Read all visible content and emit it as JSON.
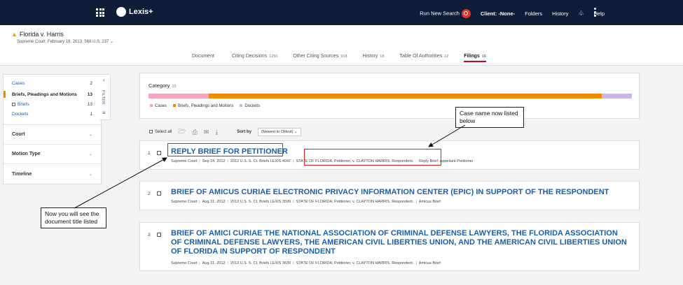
{
  "topbar": {
    "logo": "Lexis+",
    "run_new_search": "Run New Search",
    "client": "Client: -None-",
    "folders": "Folders",
    "history": "History",
    "help": "Help"
  },
  "case": {
    "title": "Florida v. Harris",
    "court": "Supreme Court",
    "date": "February 19, 2013",
    "citation": "568 U.S. 237"
  },
  "tabs": [
    {
      "label": "Document",
      "count": ""
    },
    {
      "label": "Citing Decisions",
      "count": "1250"
    },
    {
      "label": "Other Citing Sources",
      "count": "918"
    },
    {
      "label": "History",
      "count": "18"
    },
    {
      "label": "Table Of Authorities",
      "count": "12"
    },
    {
      "label": "Filings",
      "count": "16"
    }
  ],
  "sidebar": {
    "cases": {
      "label": "Cases",
      "count": "2"
    },
    "briefs_pleadings": {
      "label": "Briefs, Pleadings and Motions",
      "count": "13"
    },
    "briefs": {
      "label": "Briefs",
      "count": "13"
    },
    "dockets": {
      "label": "Dockets",
      "count": "1"
    },
    "sections": [
      "Court",
      "Motion Type",
      "Timeline"
    ],
    "filter_label": "FILTER"
  },
  "category": {
    "title": "Category",
    "count": "16",
    "legend": [
      {
        "label": "Cases",
        "color": "#f2a6c4"
      },
      {
        "label": "Briefs, Pleadings and Motions",
        "color": "#f08c00"
      },
      {
        "label": "Dockets",
        "color": "#c9b6e4"
      }
    ],
    "values": [
      2,
      13,
      1
    ]
  },
  "toolbar": {
    "select_all": "Select all",
    "sort_by": "Sort by",
    "sort_value": "(Newest to Oldest)"
  },
  "results": [
    {
      "num": "1",
      "title": "REPLY BRIEF FOR PETITIONER",
      "court": "Supreme Court",
      "date": "Sep 24, 2012",
      "cite": "2012 U.S. S. Ct. Briefs LEXIS 4047",
      "parties": "STATE OF FLORIDA, Petitioner, v. CLAYTON HARRIS, Respondent.",
      "type": "Reply Brief: Appellant-Petitioner"
    },
    {
      "num": "2",
      "title": "BRIEF OF AMICUS CURIAE ELECTRONIC PRIVACY INFORMATION CENTER (EPIC) IN SUPPORT OF THE RESPONDENT",
      "court": "Supreme Court",
      "date": "Aug 31, 2012",
      "cite": "2012 U.S. S. Ct. Briefs LEXIS 3599",
      "parties": "STATE OF FLORIDA, Petitioner, v. CLAYTON HARRIS, Respondent.",
      "type": "Amicus Brief"
    },
    {
      "num": "3",
      "title": "BRIEF OF AMICI CURIAE THE NATIONAL ASSOCIATION OF CRIMINAL DEFENSE LAWYERS, THE FLORIDA ASSOCIATION OF CRIMINAL DEFENSE LAWYERS, THE AMERICAN CIVIL LIBERTIES UNION, AND THE AMERICAN CIVIL LIBERTIES UNION OF FLORIDA IN SUPPORT OF RESPONDENT",
      "court": "Supreme Court",
      "date": "Aug 31, 2012",
      "cite": "2012 U.S. S. Ct. Briefs LEXIS 3639",
      "parties": "STATE OF FLORIDA, Petitioner, v. CLAYTON HARRIS, Respondent.",
      "type": "Amicus Brief"
    }
  ],
  "callouts": {
    "case_name": "Case name now listed below",
    "doc_title": "Now you will see the document title listed"
  },
  "colors": {
    "accent": "#1a5fa9",
    "highlight": "#e02020",
    "topbar": "#0f1d39"
  }
}
